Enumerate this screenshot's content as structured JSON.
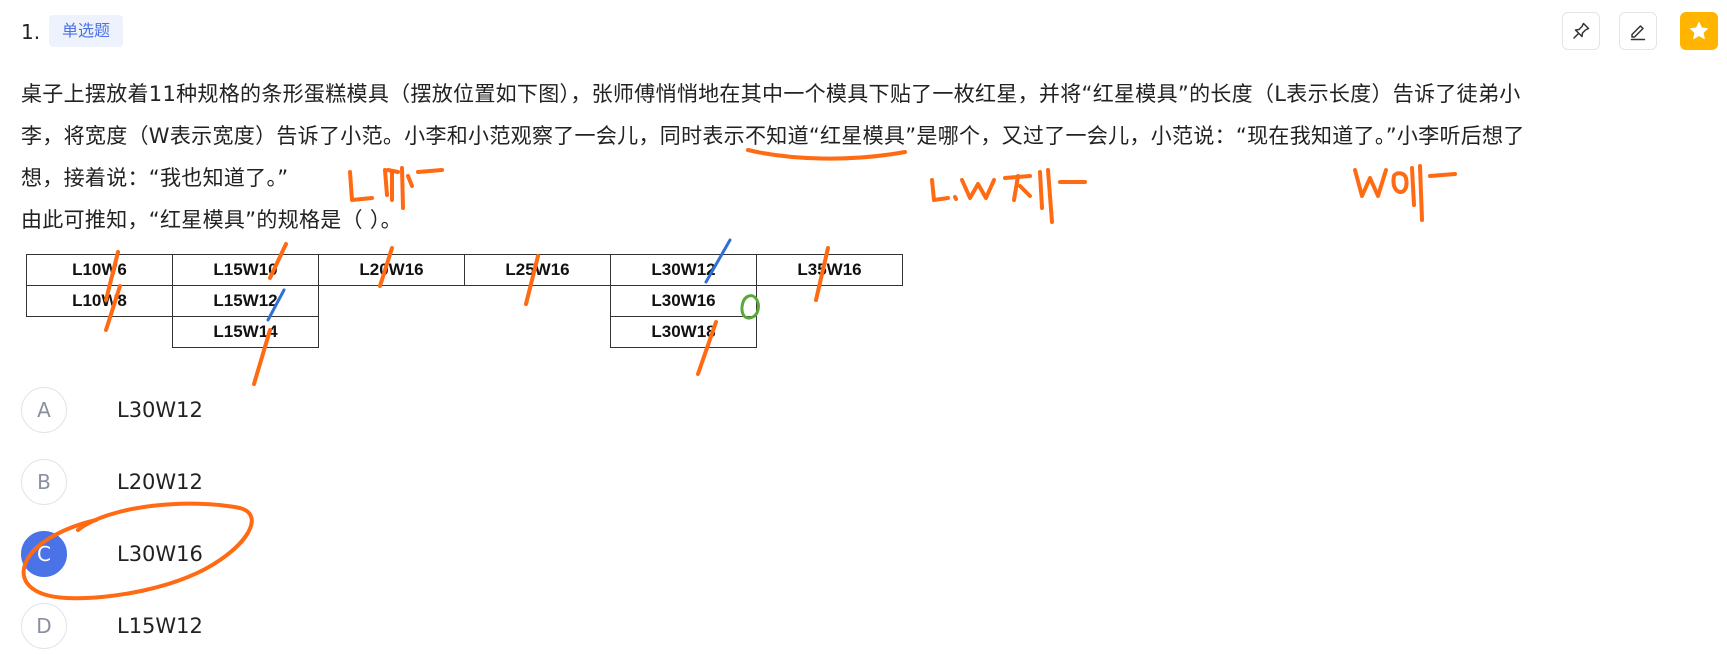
{
  "question": {
    "number": "1.",
    "type_badge": "单选题",
    "stem_line1": "桌子上摆放着11种规格的条形蛋糕模具（摆放位置如下图），张师傅悄悄地在其中一个模具下贴了一枚红星，并将“红星模具”的长度（L表示长度）告诉了徒弟小",
    "stem_line2_a": "李，将宽度（W表示宽度）告诉了小范。小李和小范观察了一会儿，",
    "stem_line2_u": "同时表示不知道",
    "stem_line2_b": "“红星模具”是哪个，又过了一会儿，小范说：“现在我知道了。”小李听后想了",
    "stem_line3": "想，接着说：“我也知道了。”",
    "stem_line4": "由此可推知，“红星模具”的规格是（ ）。"
  },
  "toolbar": {
    "pin_icon": "pin-icon",
    "edit_icon": "pencil-icon",
    "star_icon": "star-icon"
  },
  "table": {
    "row1": [
      "L10W6",
      "L15W10",
      "L20W16",
      "L25W16",
      "L30W12",
      "L35W16"
    ],
    "row2": [
      "L10W8",
      "L15W12",
      "",
      "",
      "L30W16",
      ""
    ],
    "row3": [
      "",
      "L15W14",
      "",
      "",
      "L30W18",
      ""
    ]
  },
  "options": [
    {
      "letter": "A",
      "text": "L30W12",
      "selected": false
    },
    {
      "letter": "B",
      "text": "L20W12",
      "selected": false
    },
    {
      "letter": "C",
      "text": "L30W16",
      "selected": true
    },
    {
      "letter": "D",
      "text": "L15W12",
      "selected": false
    }
  ],
  "colors": {
    "accent": "#4b73e8",
    "badge_bg": "#eef2fc",
    "star_bg": "#ffb400",
    "ink_orange": "#ff6a13",
    "ink_blue": "#2f6fd6",
    "ink_green": "#5aa83a"
  }
}
